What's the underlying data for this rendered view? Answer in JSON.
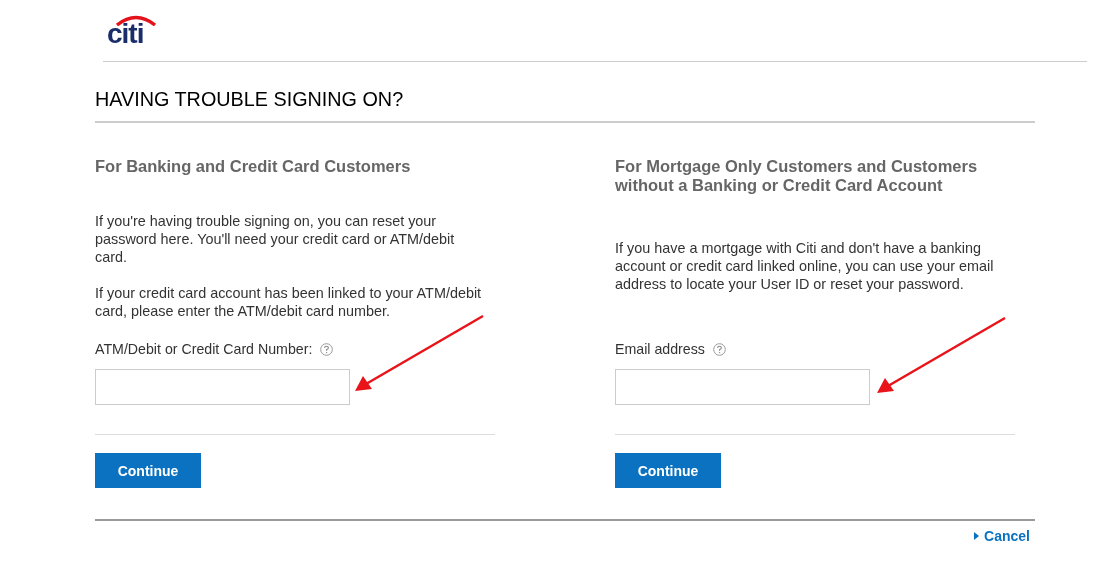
{
  "logo": {
    "text": "citi"
  },
  "page_title": "HAVING TROUBLE SIGNING ON?",
  "sections": [
    {
      "heading": "For Banking and Credit Card Customers",
      "paragraphs": [
        "If you're having trouble signing on, you can reset your password here. You'll need your credit card or ATM/debit card.",
        "If your credit card account has been linked to your ATM/debit card, please enter the ATM/debit card number."
      ],
      "field_label": "ATM/Debit or Credit Card Number:",
      "button": "Continue"
    },
    {
      "heading": "For Mortgage Only Customers and Customers without a Banking or Credit Card Account",
      "paragraphs": [
        "If you have a mortgage with Citi and don't have a banking account or credit card linked online, you can use your email address to locate your User ID or reset your password."
      ],
      "field_label": "Email address",
      "button": "Continue"
    }
  ],
  "cancel_link": "Cancel"
}
